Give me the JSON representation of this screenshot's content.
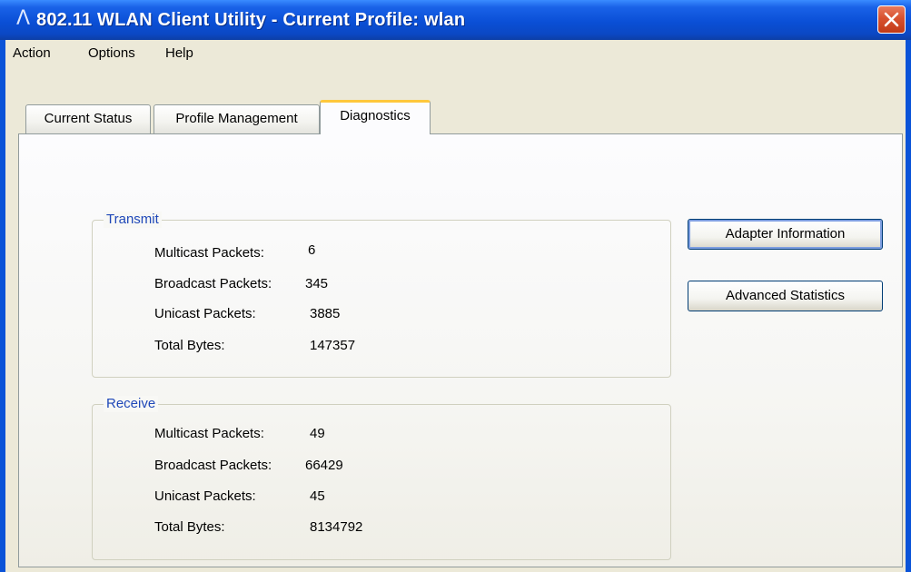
{
  "window": {
    "title": "802.11 WLAN Client Utility - Current Profile: wlan",
    "app_icon": "antenna-icon",
    "close_icon": "close-icon"
  },
  "menu": {
    "items": [
      {
        "label": "Action"
      },
      {
        "label": "Options"
      },
      {
        "label": "Help"
      }
    ]
  },
  "tabs": [
    {
      "label": "Current Status"
    },
    {
      "label": "Profile Management"
    },
    {
      "label": "Diagnostics",
      "active": true
    }
  ],
  "transmit": {
    "title": "Transmit",
    "rows": [
      {
        "label": "Multicast Packets:",
        "value": "6"
      },
      {
        "label": "Broadcast Packets:",
        "value": "345"
      },
      {
        "label": "Unicast Packets:",
        "value": "3885"
      },
      {
        "label": "Total Bytes:",
        "value": "147357"
      }
    ]
  },
  "receive": {
    "title": "Receive",
    "rows": [
      {
        "label": "Multicast Packets:",
        "value": "49"
      },
      {
        "label": "Broadcast Packets:",
        "value": "66429"
      },
      {
        "label": "Unicast Packets:",
        "value": "45"
      },
      {
        "label": "Total Bytes:",
        "value": "8134792"
      }
    ]
  },
  "buttons": {
    "adapter_info": "Adapter Information",
    "advanced_stats": "Advanced Statistics"
  },
  "colors": {
    "titlebar": "#0a4fd6",
    "group_title": "#1f48b8",
    "tab_highlight": "#ffc83c"
  }
}
